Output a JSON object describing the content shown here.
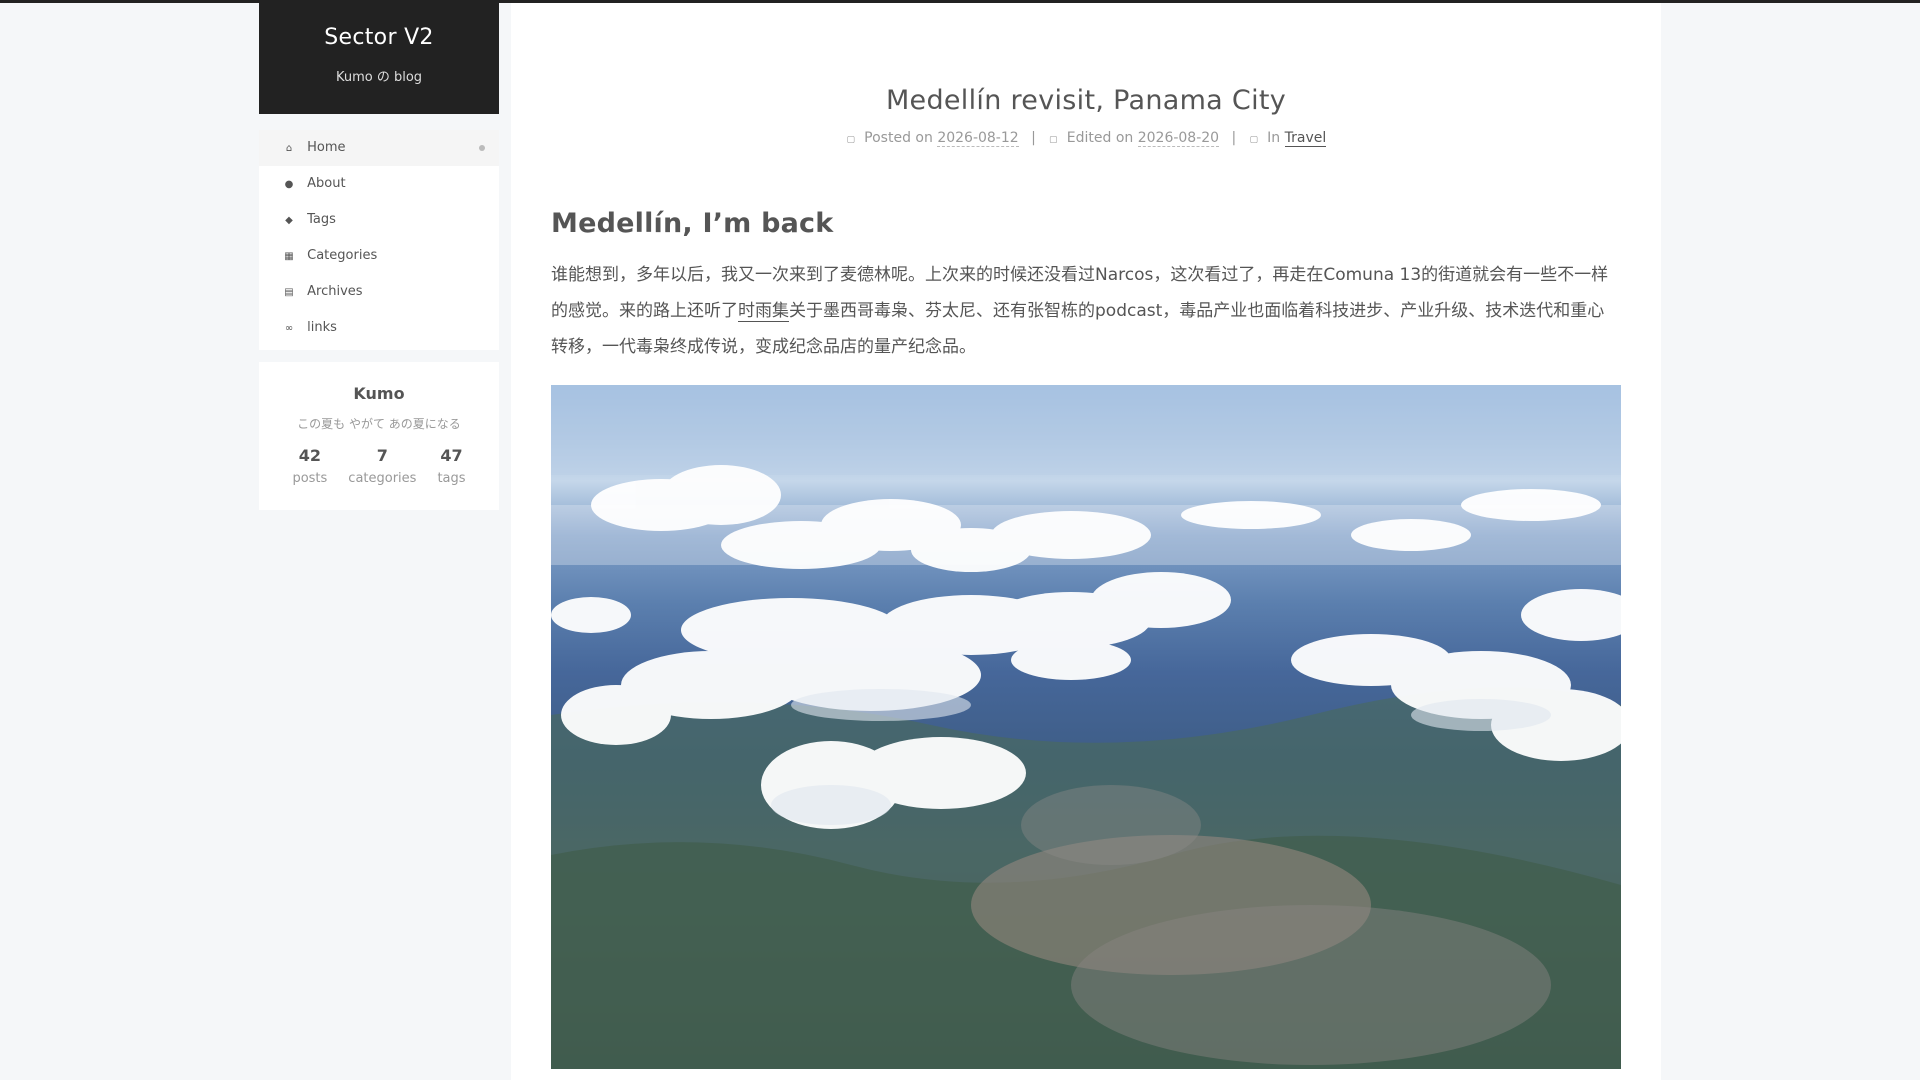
{
  "site": {
    "title": "Sector V2",
    "subtitle": "Kumo の blog"
  },
  "menu": {
    "items": [
      {
        "label": "Home",
        "icon": "home-icon",
        "active": true
      },
      {
        "label": "About",
        "icon": "user-icon"
      },
      {
        "label": "Tags",
        "icon": "tags-icon"
      },
      {
        "label": "Categories",
        "icon": "th-icon"
      },
      {
        "label": "Archives",
        "icon": "archive-icon"
      },
      {
        "label": "links",
        "icon": "link-icon"
      }
    ]
  },
  "author": {
    "name": "Kumo",
    "motto": "この夏も やがて あの夏になる",
    "stats": [
      {
        "num": "42",
        "label": "posts"
      },
      {
        "num": "7",
        "label": "categories"
      },
      {
        "num": "47",
        "label": "tags"
      }
    ]
  },
  "post": {
    "title": "Medellín revisit, Panama City",
    "meta": {
      "posted_label": "Posted on",
      "posted_date": "2026-08-12",
      "edited_label": "Edited on",
      "edited_date": "2026-08-20",
      "in_label": "In",
      "category": "Travel",
      "separator": "|"
    },
    "heading": "Medellín, I’m back",
    "paragraph_before_link": "谁能想到，多年以后，我又一次来到了麦德林呢。上次来的时候还没看过Narcos，这次看过了，再走在Comuna 13的街道就会有一些不一样的感觉。来的路上还听了",
    "paragraph_link": "时雨集",
    "paragraph_after_link": "关于墨西哥毒枭、芬太尼、还有张智栋的podcast，毒品产业也面临着科技进步、产业升级、技术迭代和重心转移，一代毒枭终成传说，变成纪念品店的量产纪念品。"
  },
  "colors": {
    "brand_bg": "#222222",
    "page_bg": "#f5f7f9",
    "text": "#555555",
    "muted": "#999999"
  }
}
